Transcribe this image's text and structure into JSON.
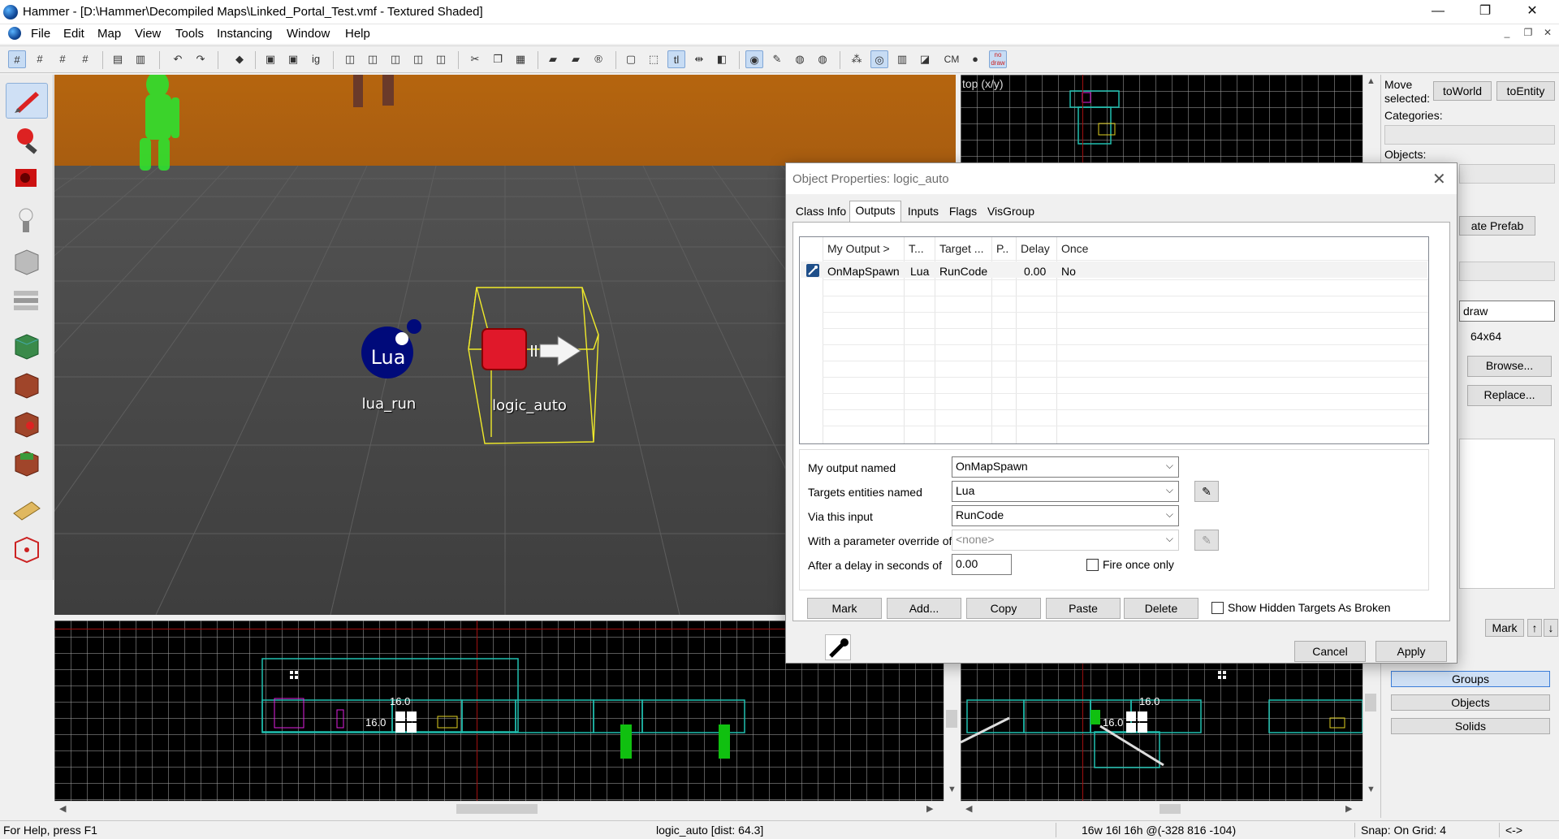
{
  "window": {
    "title": "Hammer - [D:\\Hammer\\Decompiled Maps\\Linked_Portal_Test.vmf - Textured Shaded]",
    "minimize": "—",
    "maximize": "❐",
    "close": "✕"
  },
  "menu": {
    "items": [
      "File",
      "Edit",
      "Map",
      "View",
      "Tools",
      "Instancing",
      "Window",
      "Help"
    ],
    "mdi_controls": [
      "_",
      "❐",
      "✕"
    ]
  },
  "toolbar": {
    "cm_label": "CM",
    "nodraw_label": "no draw"
  },
  "viewport3d": {
    "entities": [
      {
        "name": "lua_run",
        "icon_text": "Lua"
      },
      {
        "name": "logic_auto",
        "icon_text": ""
      }
    ]
  },
  "viewport_top": {
    "label": "top (x/y)",
    "grid_label_1": "16.0",
    "grid_label_2": "16.0"
  },
  "viewport_bottom_left": {
    "grid_label_1": "16.0",
    "grid_label_2": "16.0"
  },
  "right_panel": {
    "move_selected_label": "Move selected:",
    "to_world": "toWorld",
    "to_entity": "toEntity",
    "categories_label": "Categories:",
    "objects_label": "Objects:",
    "create_prefab": "ate Prefab",
    "texture_name": "draw",
    "texture_size": "64x64",
    "browse": "Browse...",
    "replace": "Replace...",
    "mark": "Mark",
    "groups": "Groups",
    "objects_btn": "Objects",
    "solids": "Solids"
  },
  "dialog": {
    "title": "Object Properties: logic_auto",
    "close": "✕",
    "tabs": [
      "Class Info",
      "Outputs",
      "Inputs",
      "Flags",
      "VisGroup"
    ],
    "active_tab": "Outputs",
    "columns": [
      "My Output  >",
      "T...",
      "Target ...",
      "P..",
      "Delay",
      "Once"
    ],
    "rows": [
      {
        "output": "OnMapSpawn",
        "target_short": "Lua",
        "input": "RunCode",
        "param": "",
        "delay": "0.00",
        "once": "No"
      }
    ],
    "form": {
      "output_label": "My output named",
      "output_value": "OnMapSpawn",
      "target_label": "Targets entities named",
      "target_value": "Lua",
      "input_label": "Via this input",
      "input_value": "RunCode",
      "param_label": "With a parameter override of",
      "param_value": "<none>",
      "delay_label": "After a delay in seconds of",
      "delay_value": "0.00",
      "fire_once_label": "Fire once only"
    },
    "buttons": {
      "mark": "Mark",
      "add": "Add...",
      "copy": "Copy",
      "paste": "Paste",
      "delete": "Delete",
      "show_hidden": "Show Hidden Targets As Broken",
      "cancel": "Cancel",
      "apply": "Apply"
    }
  },
  "statusbar": {
    "help": "For Help, press F1",
    "selection": "logic_auto  [dist: 64.3]",
    "size": "16w 16l 16h @(-328 816 -104)",
    "snap": "Snap: On Grid: 4",
    "arrows": "<->"
  }
}
